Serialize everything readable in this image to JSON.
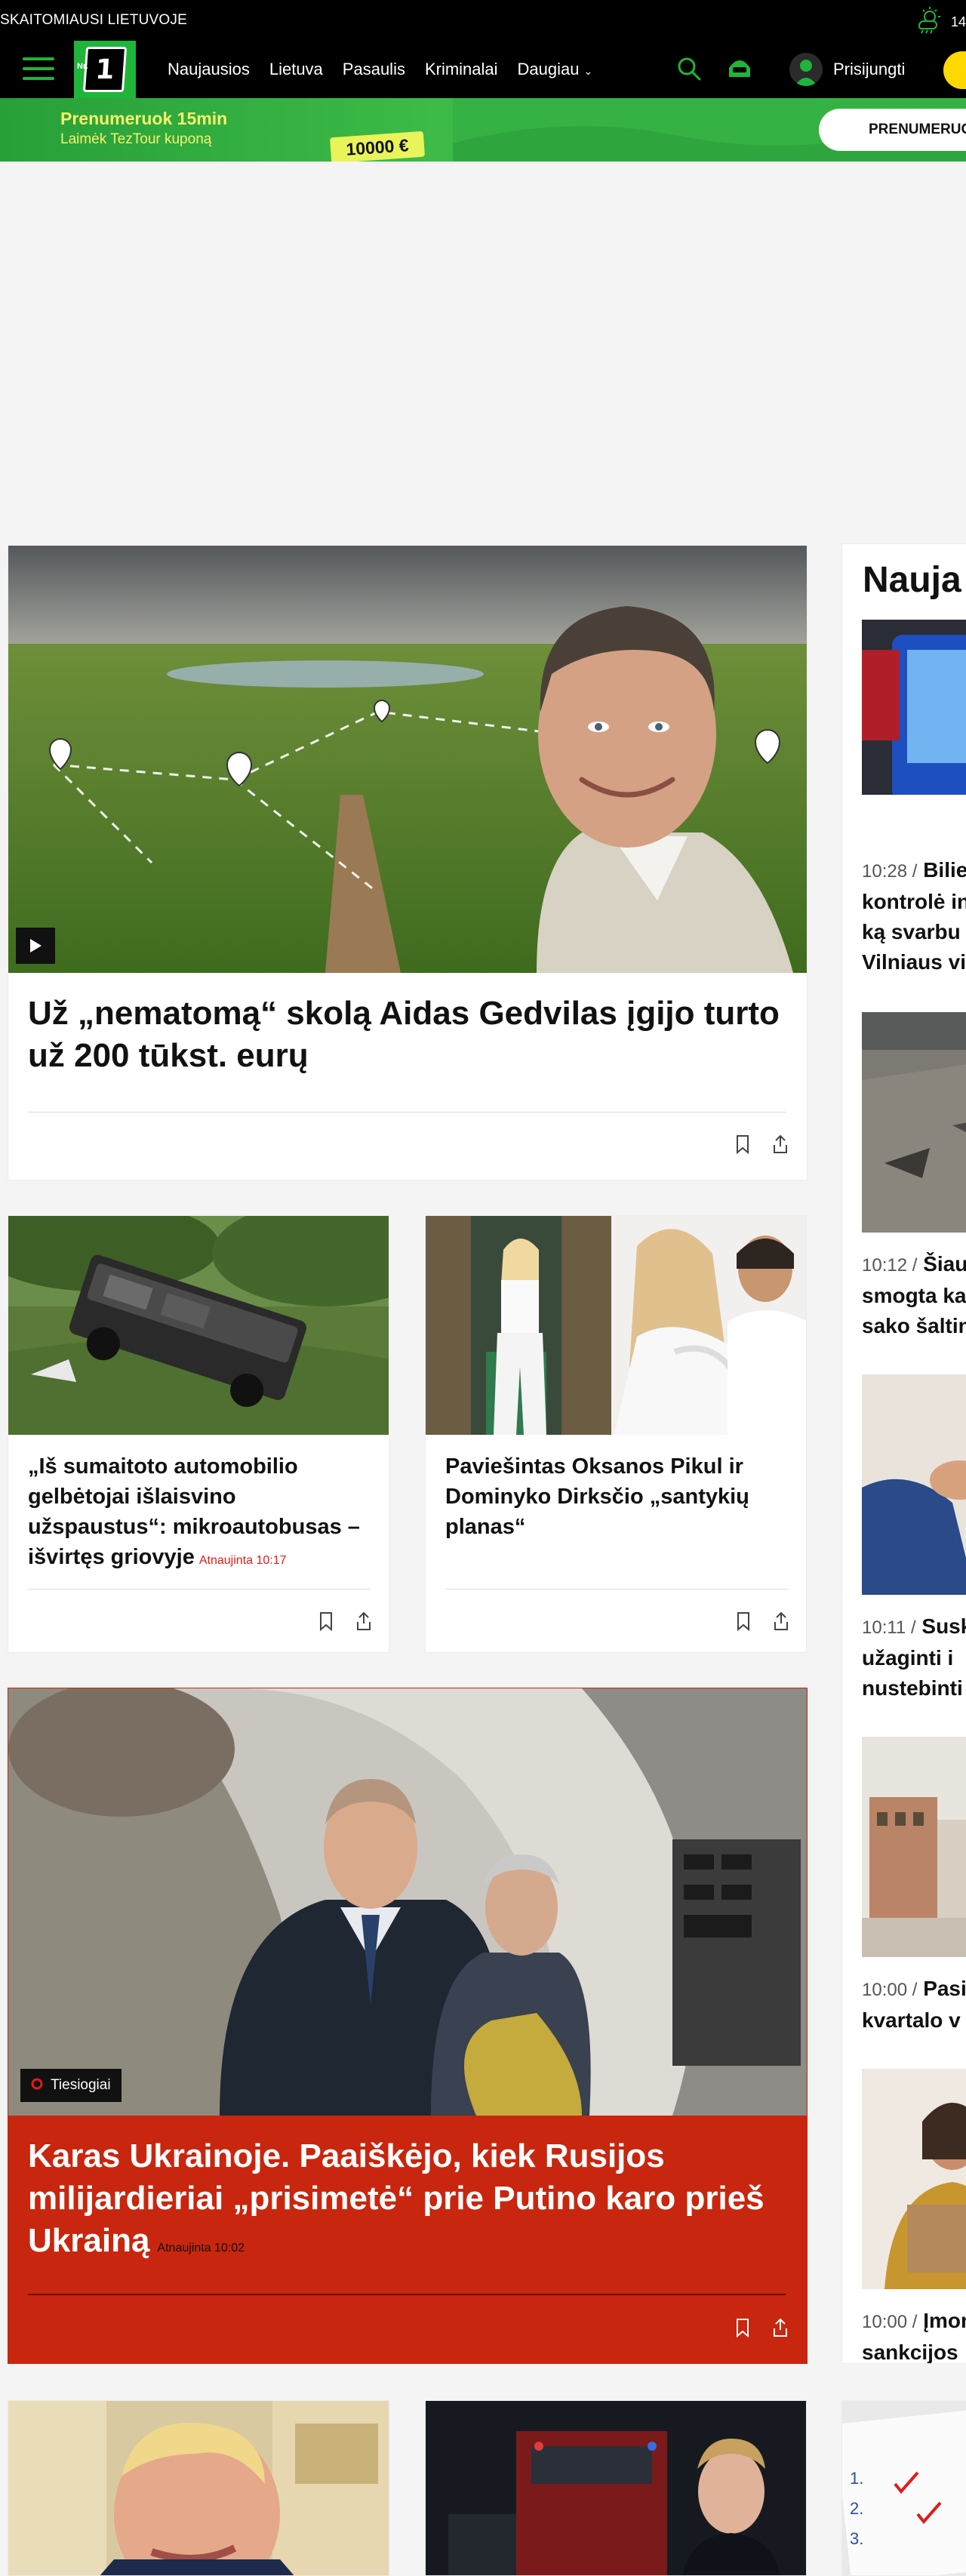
{
  "topbar": {
    "tagline": "SKAITOMIAUSI LIETUVOJE",
    "temperature": "14"
  },
  "nav": {
    "logo_text": "1",
    "logo_prefix": "Nr.",
    "items": [
      "Naujausios",
      "Lietuva",
      "Pasaulis",
      "Kriminalai",
      "Daugiau"
    ],
    "login_label": "Prisijungti"
  },
  "promo": {
    "headline": "Prenumeruok 15min",
    "subline": "Laimėk TezTour kuponą",
    "prize": "10000 €",
    "cta": "PRENUMERUO"
  },
  "main": {
    "lead": {
      "title": "Už „nematomą“ skolą Aidas Gedvilas įgijo turto už 200 tūkst. eurų"
    },
    "pair1": [
      {
        "title": "„Iš sumaitoto automobilio gelbėtojai išlaisvino užspaustus“: mikroautobusas – išvirtęs griovyje",
        "updated": "Atnaujinta 10:17"
      },
      {
        "title": "Paviešintas Oksanos Pikul ir Dominyko Dirksčio „santykių planas“",
        "updated": ""
      }
    ],
    "live": {
      "badge": "Tiesiogiai",
      "title": "Karas Ukrainoje. Paaiškėjo, kiek Rusijos milijardieriai „prisimetė“ prie Putino karo prieš Ukrainą",
      "updated": "Atnaujinta 10:02"
    }
  },
  "sidebar": {
    "heading": "Nauja",
    "items": [
      {
        "time": "10:28 /",
        "lines": [
          "Bilie",
          "kontrolė in",
          "ką svarbu",
          "Vilniaus vi"
        ]
      },
      {
        "time": "10:12 /",
        "lines": [
          "Šiaur",
          "smogta ka",
          "sako šaltin"
        ]
      },
      {
        "time": "10:11 /",
        "lines": [
          "Susk",
          "užaginti i",
          "nustebinti"
        ]
      },
      {
        "time": "10:00 /",
        "lines": [
          "Pasi",
          "kvartalo v"
        ]
      },
      {
        "time": "10:00 /",
        "lines": [
          "Įmon",
          "sankcijos"
        ]
      }
    ]
  }
}
